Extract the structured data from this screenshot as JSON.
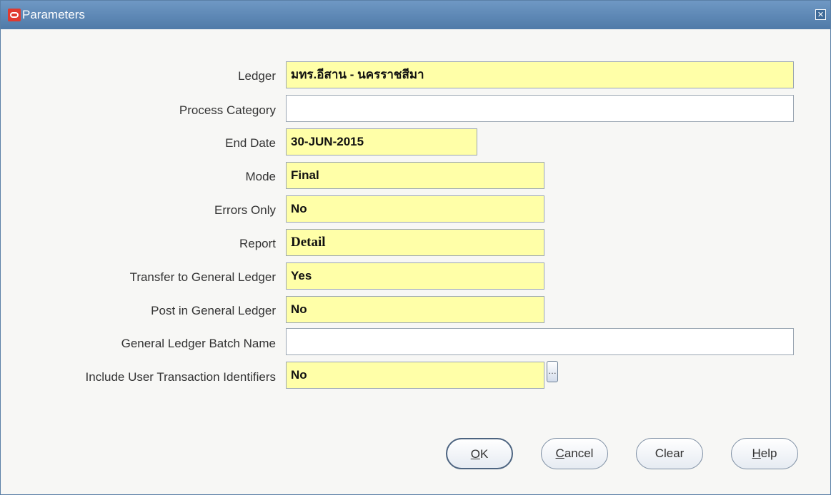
{
  "window": {
    "title": "Parameters",
    "close_glyph": "✕"
  },
  "fields": [
    {
      "id": "ledger",
      "label": "Ledger",
      "value": "มทร.อีสาน - นครราชสีมา",
      "required": true
    },
    {
      "id": "process_category",
      "label": "Process Category",
      "value": "",
      "required": false
    },
    {
      "id": "end_date",
      "label": "End Date",
      "value": "30-JUN-2015",
      "required": true
    },
    {
      "id": "mode",
      "label": "Mode",
      "value": "Final",
      "required": true
    },
    {
      "id": "errors_only",
      "label": "Errors Only",
      "value": "No",
      "required": true
    },
    {
      "id": "report",
      "label": "Report",
      "value": "Detail",
      "required": true
    },
    {
      "id": "transfer_gl",
      "label": "Transfer to General Ledger",
      "value": "Yes",
      "required": true
    },
    {
      "id": "post_gl",
      "label": "Post in General Ledger",
      "value": "No",
      "required": true
    },
    {
      "id": "gl_batch_name",
      "label": "General Ledger Batch Name",
      "value": "",
      "required": false
    },
    {
      "id": "include_user_txn",
      "label": "Include User Transaction Identifiers",
      "value": "No",
      "required": true
    }
  ],
  "lov_button": {
    "glyph": "…"
  },
  "buttons": {
    "ok": {
      "mnemonic": "O",
      "rest": "K"
    },
    "cancel": {
      "mnemonic": "C",
      "rest": "ancel"
    },
    "clear": {
      "label": "Clear"
    },
    "help": {
      "mnemonic": "H",
      "rest": "elp"
    }
  },
  "colors": {
    "title_bar": "#5a86b4",
    "required_field": "#ffffa8",
    "optional_field": "#ffffff"
  }
}
